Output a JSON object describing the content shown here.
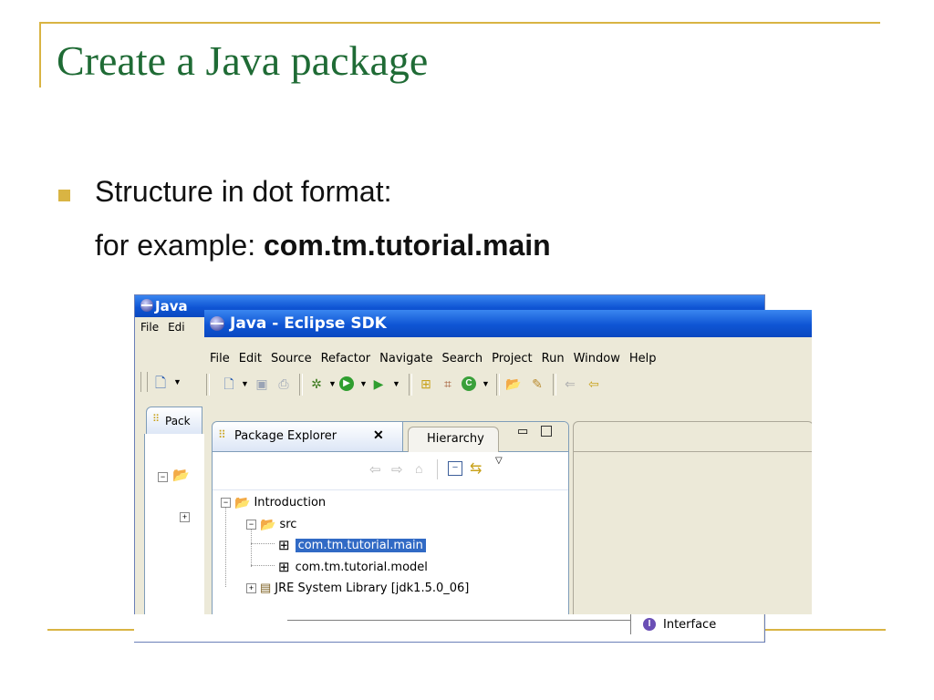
{
  "slide": {
    "title": "Create a Java package",
    "bullet": "Structure in dot format:",
    "example_prefix": "for example: ",
    "example_value": "com.tm.tutorial.main"
  },
  "back_window": {
    "title": "Java",
    "menu": [
      "File",
      "Edi"
    ],
    "tab_label": "Pack"
  },
  "window": {
    "title": "Java - Eclipse SDK",
    "menu": [
      "File",
      "Edit",
      "Source",
      "Refactor",
      "Navigate",
      "Search",
      "Project",
      "Run",
      "Window",
      "Help"
    ]
  },
  "package_explorer": {
    "tab_label": "Package Explorer",
    "close_glyph": "✕",
    "other_tab": "Hierarchy",
    "tree": {
      "project": "Introduction",
      "src": "src",
      "packages": [
        "com.tm.tutorial.main",
        "com.tm.tutorial.model"
      ],
      "library": "JRE System Library [jdk1.5.0_06]"
    }
  },
  "peek": {
    "interface_label": "Interface"
  },
  "colors": {
    "accent_gold": "#d9b443",
    "title_green": "#1f6b35",
    "selection_blue": "#316ac5",
    "titlebar_blue": "#0f55d4"
  },
  "icons": {
    "new": "new-wizard-icon",
    "save": "save-icon",
    "print": "print-icon",
    "debug": "debug-icon",
    "run": "run-icon",
    "external": "external-tools-icon",
    "new_project": "new-java-project-icon",
    "new_package": "new-package-icon",
    "new_class": "new-class-icon",
    "open_type": "open-type-icon",
    "search": "search-icon",
    "back": "back-arrow-icon",
    "forward": "forward-arrow-icon"
  }
}
